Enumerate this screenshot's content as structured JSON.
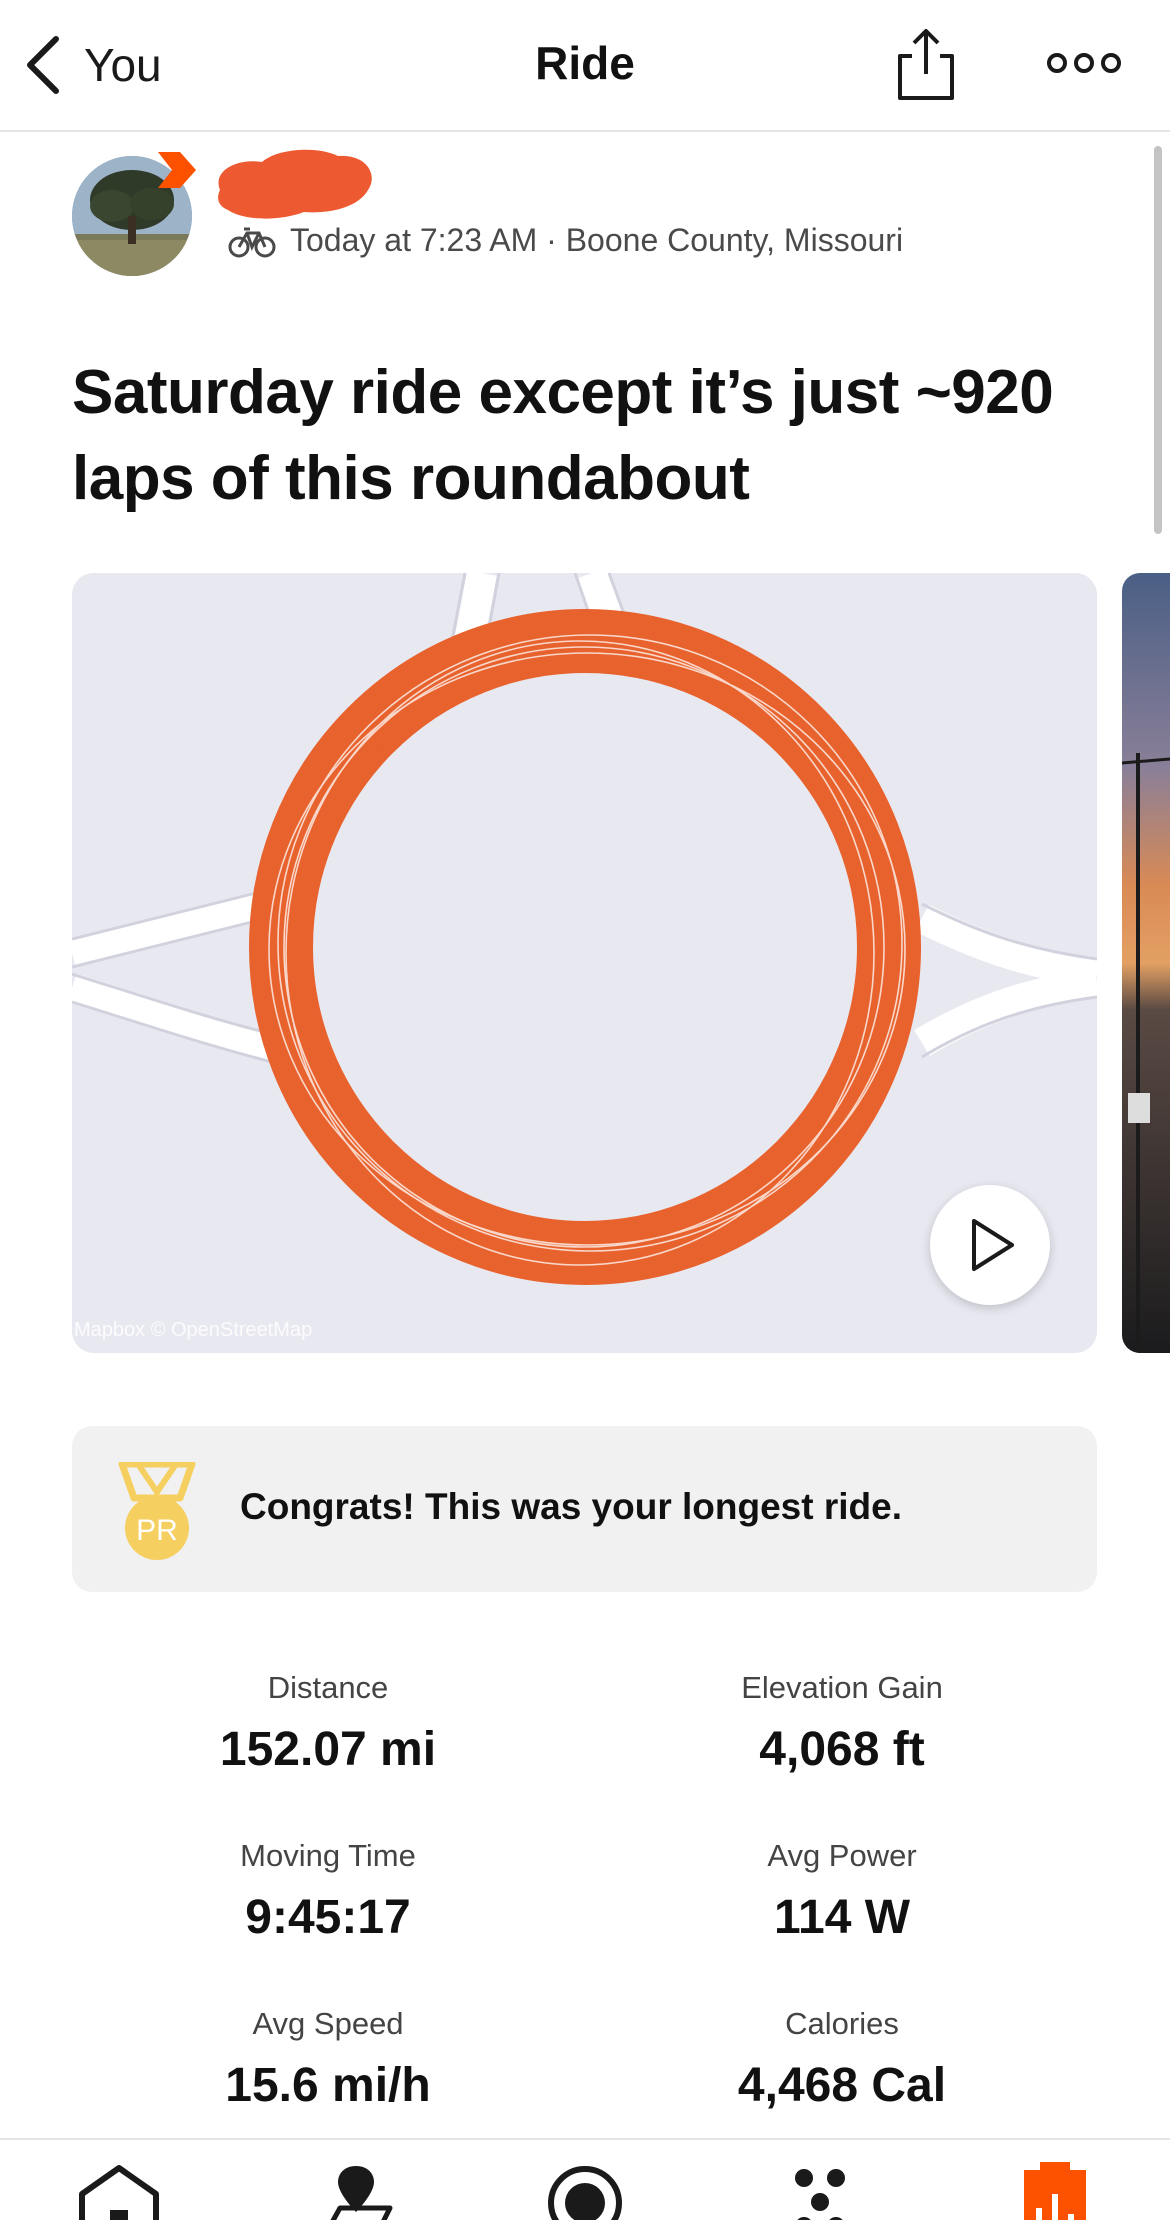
{
  "header": {
    "back_label": "You",
    "title": "Ride"
  },
  "athlete": {
    "meta": "Today at 7:23 AM · Boone County, Missouri",
    "activity_icon": "bike-icon"
  },
  "activity": {
    "title": "Saturday ride except it’s just ~920 laps of this roundabout"
  },
  "map": {
    "attribution": "Mapbox © OpenStreetMap",
    "route_color": "#e8622d"
  },
  "achievement": {
    "badge_text": "PR",
    "text": "Congrats! This was your longest ride."
  },
  "stats": [
    {
      "label": "Distance",
      "value": "152.07 mi"
    },
    {
      "label": "Elevation Gain",
      "value": "4,068 ft"
    },
    {
      "label": "Moving Time",
      "value": "9:45:17"
    },
    {
      "label": "Avg Power",
      "value": "114 W"
    },
    {
      "label": "Avg Speed",
      "value": "15.6 mi/h"
    },
    {
      "label": "Calories",
      "value": "4,468 Cal"
    }
  ],
  "nav": {
    "items": [
      "home-icon",
      "maps-icon",
      "record-icon",
      "groups-icon",
      "you-icon"
    ],
    "active": "you-icon",
    "accent_color": "#fc5200"
  }
}
